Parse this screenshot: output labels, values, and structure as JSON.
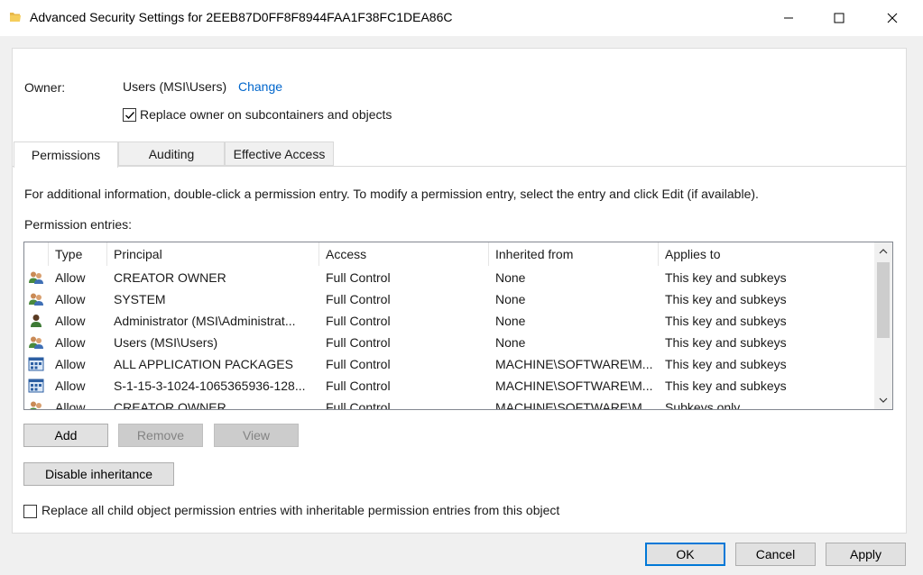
{
  "window": {
    "title": "Advanced Security Settings for 2EEB87D0FF8F8944FAA1F38FC1DEA86C"
  },
  "owner": {
    "label": "Owner:",
    "value": "Users (MSI\\Users)",
    "change_link": "Change",
    "replace_label": "Replace owner on subcontainers and objects",
    "replace_checked": true
  },
  "tabs": [
    {
      "label": "Permissions",
      "active": true
    },
    {
      "label": "Auditing",
      "active": false
    },
    {
      "label": "Effective Access",
      "active": false
    }
  ],
  "permissions": {
    "info": "For additional information, double-click a permission entry. To modify a permission entry, select the entry and click Edit (if available).",
    "entries_label": "Permission entries:",
    "columns": [
      "Type",
      "Principal",
      "Access",
      "Inherited from",
      "Applies to"
    ],
    "rows": [
      {
        "icon": "group-user-icon",
        "type": "Allow",
        "principal": "CREATOR OWNER",
        "access": "Full Control",
        "inherited": "None",
        "applies": "This key and subkeys"
      },
      {
        "icon": "group-user-icon",
        "type": "Allow",
        "principal": "SYSTEM",
        "access": "Full Control",
        "inherited": "None",
        "applies": "This key and subkeys"
      },
      {
        "icon": "single-user-icon",
        "type": "Allow",
        "principal": "Administrator (MSI\\Administrat...",
        "access": "Full Control",
        "inherited": "None",
        "applies": "This key and subkeys"
      },
      {
        "icon": "group-user-icon",
        "type": "Allow",
        "principal": "Users (MSI\\Users)",
        "access": "Full Control",
        "inherited": "None",
        "applies": "This key and subkeys"
      },
      {
        "icon": "app-package-icon",
        "type": "Allow",
        "principal": "ALL APPLICATION PACKAGES",
        "access": "Full Control",
        "inherited": "MACHINE\\SOFTWARE\\M...",
        "applies": "This key and subkeys"
      },
      {
        "icon": "app-package-icon",
        "type": "Allow",
        "principal": "S-1-15-3-1024-1065365936-128...",
        "access": "Full Control",
        "inherited": "MACHINE\\SOFTWARE\\M...",
        "applies": "This key and subkeys"
      },
      {
        "icon": "group-user-icon",
        "type": "Allow",
        "principal": "CREATOR OWNER",
        "access": "Full Control",
        "inherited": "MACHINE\\SOFTWARE\\M...",
        "applies": "Subkeys only"
      }
    ]
  },
  "buttons": {
    "add": "Add",
    "remove": "Remove",
    "view": "View",
    "disable_inheritance": "Disable inheritance",
    "ok": "OK",
    "cancel": "Cancel",
    "apply": "Apply"
  },
  "replace_child": {
    "label": "Replace all child object permission entries with inheritable permission entries from this object",
    "checked": false
  },
  "colors": {
    "link": "#0066cc",
    "default_button_border": "#0078d7"
  }
}
